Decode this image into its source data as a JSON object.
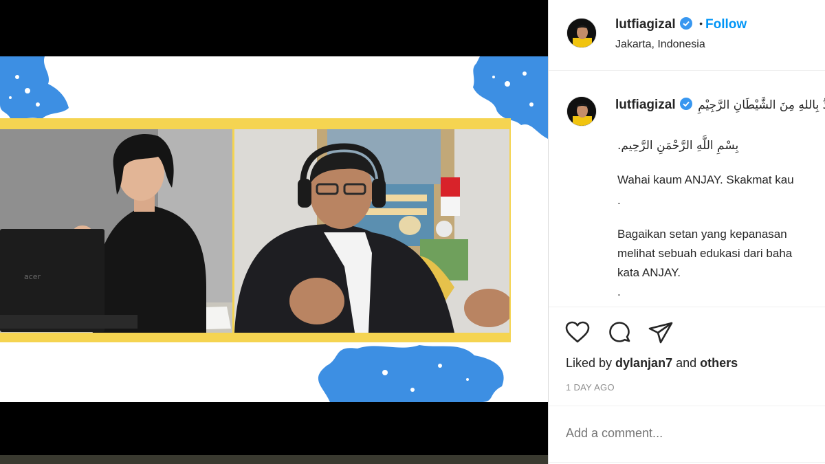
{
  "post": {
    "username": "lutfiagizal",
    "follow_label": "Follow",
    "dot": "•",
    "location": "Jakarta, Indonesia"
  },
  "caption": {
    "username": "lutfiagizal",
    "line1_arabic": "أَعُوْذُ بِاللهِ مِنَ الشَّيْطَانِ الرَّجِيْمِ",
    "line2_arabic": ".بِسْمِ اللَّهِ الرَّحْمَنِ الرَّحِيم",
    "line3": "Wahai kaum ANJAY. Skakmat kau",
    "dot1": ".",
    "line4": "Bagaikan setan yang kepanasan",
    "line5": "melihat sebuah edukasi dari baha",
    "line6": "kata ANJAY.",
    "dot2": "."
  },
  "engagement": {
    "liked_by_prefix": "Liked by ",
    "liked_by_user": "dylanjan7",
    "liked_by_suffix": " and ",
    "others": "others",
    "time_ago": "1 DAY AGO"
  },
  "comment": {
    "placeholder": "Add a comment..."
  },
  "media": {
    "laptop_brand": "acer"
  },
  "icons": [
    "verified-badge-icon",
    "heart-icon",
    "comment-icon",
    "share-icon"
  ],
  "colors": {
    "accent_blue": "#0095f6",
    "frame_yellow": "#f5d451",
    "splash_blue": "#3d8fe3",
    "text_dark": "#262626",
    "text_muted": "#8e8e8e"
  }
}
